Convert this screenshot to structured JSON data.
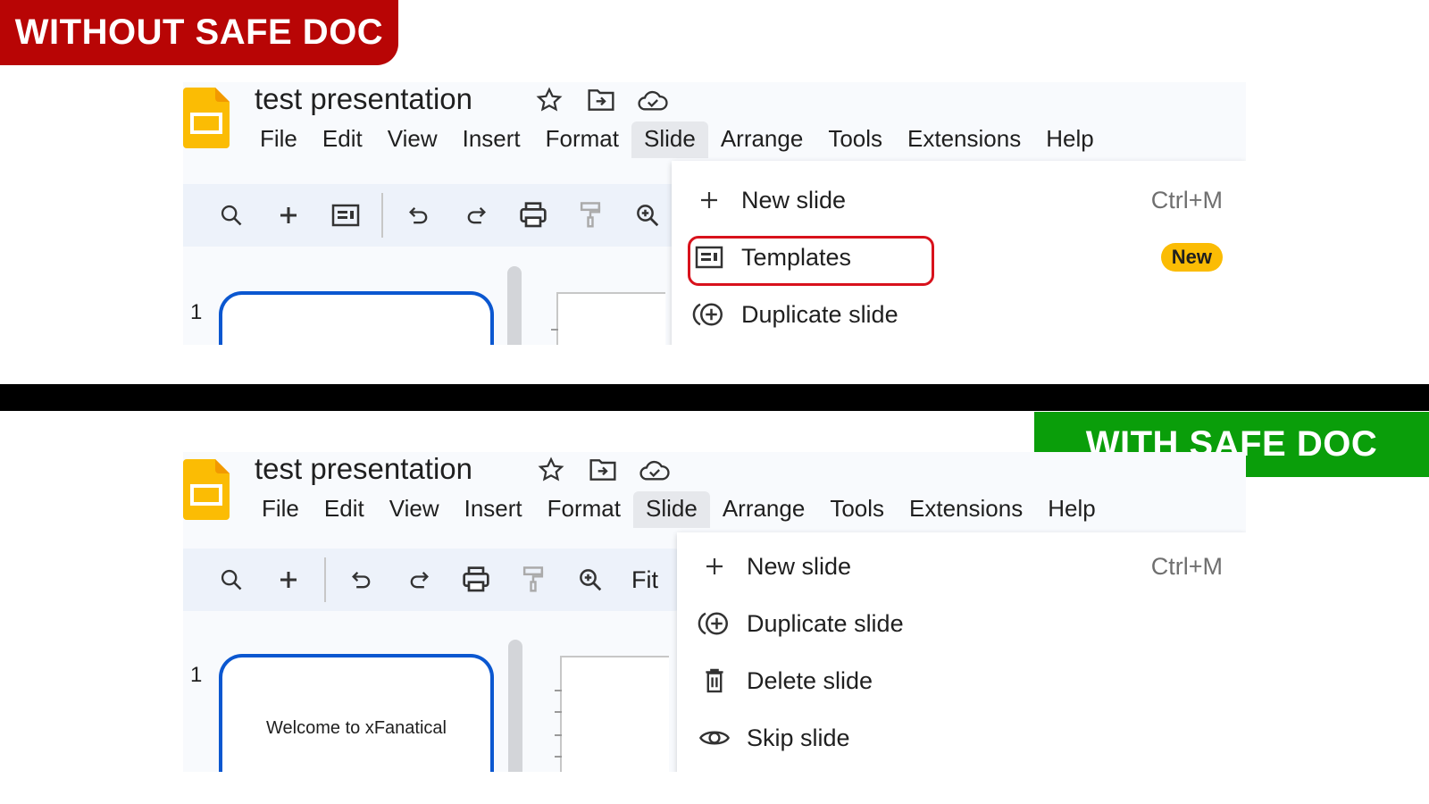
{
  "banners": {
    "without": "WITHOUT SAFE DOC",
    "with": "WITH SAFE DOC",
    "colors": {
      "without": "#b80505",
      "with": "#0a9e0a"
    }
  },
  "app": {
    "title": "test presentation",
    "title_icons": [
      "star-icon",
      "move-to-folder-icon",
      "cloud-saved-icon"
    ],
    "menu": [
      "File",
      "Edit",
      "View",
      "Insert",
      "Format",
      "Slide",
      "Arrange",
      "Tools",
      "Extensions",
      "Help"
    ],
    "active_menu": "Slide"
  },
  "without_safe_doc": {
    "toolbar": [
      "search-icon",
      "new-slide-icon",
      "templates-icon",
      "undo-icon",
      "redo-icon",
      "print-icon",
      "paint-format-icon",
      "zoom-icon"
    ],
    "slide_number": "1",
    "slide_menu": [
      {
        "icon": "plus-icon",
        "label": "New slide",
        "shortcut": "Ctrl+M"
      },
      {
        "icon": "templates-icon",
        "label": "Templates",
        "badge": "New",
        "highlighted": true
      },
      {
        "icon": "duplicate-icon",
        "label": "Duplicate slide"
      }
    ]
  },
  "with_safe_doc": {
    "toolbar": [
      "search-icon",
      "new-slide-icon",
      "undo-icon",
      "redo-icon",
      "print-icon",
      "paint-format-icon",
      "zoom-icon"
    ],
    "zoom_label": "Fit",
    "slide_number": "1",
    "slide_thumb_text": "Welcome to xFanatical",
    "slide_menu": [
      {
        "icon": "plus-icon",
        "label": "New slide",
        "shortcut": "Ctrl+M"
      },
      {
        "icon": "duplicate-icon",
        "label": "Duplicate slide"
      },
      {
        "icon": "trash-icon",
        "label": "Delete slide"
      },
      {
        "icon": "eye-icon",
        "label": "Skip slide"
      }
    ]
  }
}
